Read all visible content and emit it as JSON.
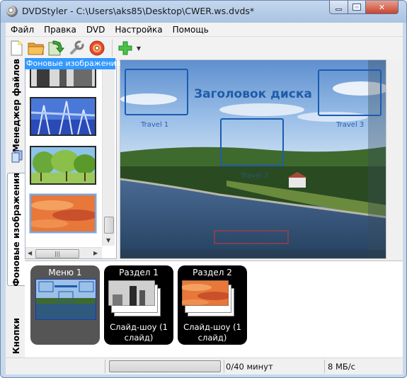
{
  "window": {
    "title": "DVDStyler - C:\\Users\\aks85\\Desktop\\CWER.ws.dvds*"
  },
  "menubar": {
    "items": [
      "Файл",
      "Правка",
      "DVD",
      "Настройка",
      "Помощь"
    ]
  },
  "toolbar": {
    "buttons": [
      "new-document-icon",
      "open-folder-icon",
      "save-icon",
      "settings-wrench-icon",
      "burn-disc-icon",
      "add-icon"
    ],
    "tooltip": "Фоновые изображения"
  },
  "sidebar": {
    "tabs": [
      {
        "label": "Менеджер файлов",
        "active": false
      },
      {
        "label": "Фоновые изображения",
        "active": true
      },
      {
        "label": "Кнопки",
        "active": false
      }
    ]
  },
  "thumbnails": [
    "dark-castle",
    "blue-winter-trees",
    "green-park",
    "sunset-clouds"
  ],
  "canvas": {
    "disc_title": "Заголовок диска",
    "buttons": [
      {
        "label": "Travel 1"
      },
      {
        "label": "Travel 2"
      },
      {
        "label": "Travel 3"
      }
    ]
  },
  "titleset": {
    "menus": [
      {
        "label": "Меню 1",
        "sub": ""
      },
      {
        "label": "Раздел 1",
        "sub": "Слайд-шоу (1 слайд)"
      },
      {
        "label": "Раздел 2",
        "sub": "Слайд-шоу (1 слайд)"
      }
    ]
  },
  "statusbar": {
    "time": "0/40 минут",
    "size": "8 МБ/с",
    "progress": 0
  },
  "colors": {
    "accent": "#1c5cb0",
    "tooltip": "#3399ff",
    "title_text": "#1f5ca8"
  }
}
